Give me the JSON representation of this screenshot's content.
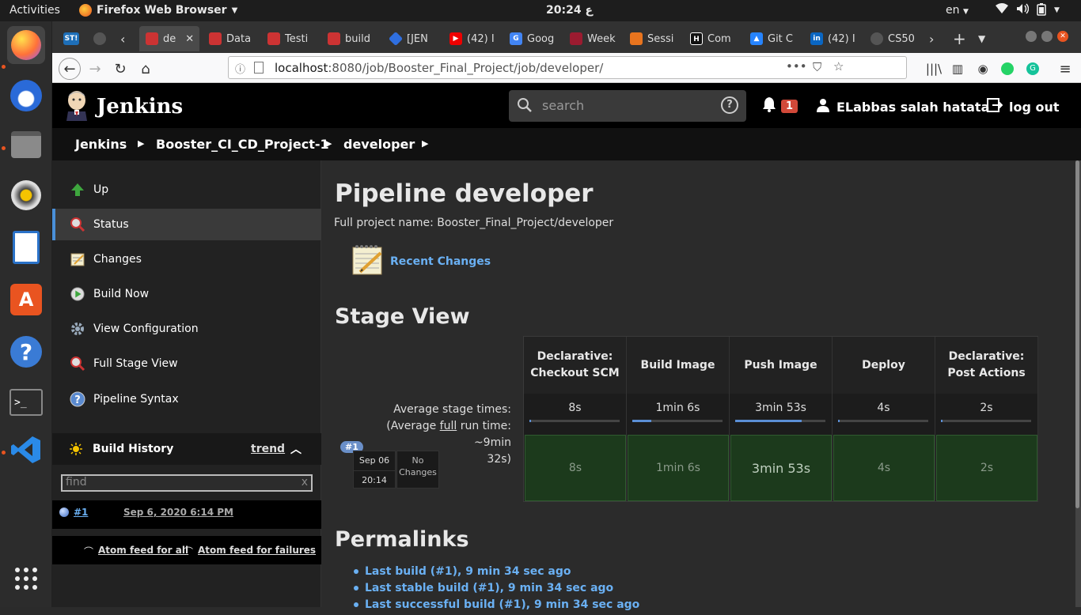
{
  "topbar": {
    "activities": "Activities",
    "app_name": "Firefox Web Browser",
    "clock": "20:24 ع",
    "lang": "en"
  },
  "dock": [
    "firefox-icon",
    "thunderbird-icon",
    "files-icon",
    "rhythmbox-icon",
    "writer-icon",
    "software-icon",
    "help-icon",
    "terminal-icon",
    "vscode-icon",
    "apps-grid-icon"
  ],
  "tabs": [
    {
      "label": "ST!",
      "color": "#1e6fb8"
    },
    {
      "label": "",
      "color": "#333"
    },
    {
      "label": "de",
      "color": "#c03"
    },
    {
      "label": "Data",
      "color": "#c03"
    },
    {
      "label": "Testi",
      "color": "#c03"
    },
    {
      "label": "build",
      "color": "#c03"
    },
    {
      "label": "[JEN",
      "color": "#2f6fe0"
    },
    {
      "label": "(42) I",
      "color": "#e00"
    },
    {
      "label": "Goog",
      "color": "#4285f4"
    },
    {
      "label": "Week",
      "color": "#9b1b30"
    },
    {
      "label": "Sessi",
      "color": "#e8741e"
    },
    {
      "label": "Com",
      "color": "#111"
    },
    {
      "label": "Git C",
      "color": "#2684ff"
    },
    {
      "label": "(42) I",
      "color": "#0a66c2"
    },
    {
      "label": "CS50",
      "color": "#333"
    }
  ],
  "url": {
    "host": "localhost",
    "path": ":8080/job/Booster_Final_Project/job/developer/"
  },
  "jenkins": {
    "title": "Jenkins",
    "search_placeholder": "search",
    "notifications": "1",
    "user": "ELabbas salah hatata",
    "logout": "log out"
  },
  "breadcrumbs": [
    "Jenkins",
    "Booster_CI_CD_Project-1",
    "developer"
  ],
  "sidebar": {
    "items": [
      {
        "label": "Up",
        "icon": "arrow-up-icon"
      },
      {
        "label": "Status",
        "icon": "magnifier-icon"
      },
      {
        "label": "Changes",
        "icon": "notepad-icon"
      },
      {
        "label": "Build Now",
        "icon": "build-now-icon"
      },
      {
        "label": "View Configuration",
        "icon": "gear-icon"
      },
      {
        "label": "Full Stage View",
        "icon": "magnifier-icon"
      },
      {
        "label": "Pipeline Syntax",
        "icon": "help-icon"
      }
    ],
    "build_history": {
      "title": "Build History",
      "trend": "trend",
      "find_placeholder": "find",
      "clear": "x",
      "builds": [
        {
          "number": "#1",
          "date": "Sep 6, 2020 6:14 PM"
        }
      ],
      "feed_all": "Atom feed for all",
      "feed_failures": "Atom feed for failures"
    }
  },
  "main": {
    "title": "Pipeline developer",
    "full_name": "Full project name: Booster_Final_Project/developer",
    "recent_changes": "Recent Changes",
    "stage_view_title": "Stage View",
    "avg_label_1": "Average stage times:",
    "avg_label_2a": "(Average ",
    "avg_label_2b": "full",
    "avg_label_2c": " run time: ~9min",
    "avg_label_3": "32s)",
    "stages": [
      {
        "name": "Declarative: Checkout SCM",
        "avg": "8s",
        "fill": 0.02,
        "cell": "8s"
      },
      {
        "name": "Build Image",
        "avg": "1min 6s",
        "fill": 0.21,
        "cell": "1min 6s"
      },
      {
        "name": "Push Image",
        "avg": "3min 53s",
        "fill": 0.74,
        "cell": "3min 53s"
      },
      {
        "name": "Deploy",
        "avg": "4s",
        "fill": 0.01,
        "cell": "4s"
      },
      {
        "name": "Declarative: Post Actions",
        "avg": "2s",
        "fill": 0.01,
        "cell": "2s"
      }
    ],
    "run": {
      "badge": "#1",
      "date": "Sep 06",
      "time": "20:14",
      "changes_1": "No",
      "changes_2": "Changes"
    },
    "permalinks_title": "Permalinks",
    "permalinks": [
      "Last build (#1), 9 min 34 sec ago",
      "Last stable build (#1), 9 min 34 sec ago",
      "Last successful build (#1), 9 min 34 sec ago"
    ]
  },
  "colors": {
    "accent": "#6ab0f3",
    "badge": "#d24939",
    "success": "#1c3a1c"
  }
}
